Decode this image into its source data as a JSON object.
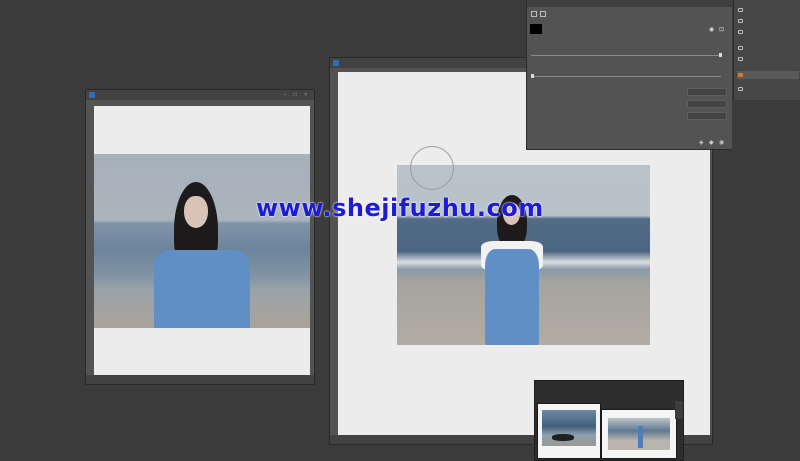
{
  "left_window": {
    "tab_title": "",
    "status": "",
    "controls": "– □ ×"
  },
  "right_window": {
    "tab_title": "",
    "status": ""
  },
  "panel": {
    "rows": [
      "",
      "",
      "",
      "",
      ""
    ],
    "buttons": [
      "",
      "",
      ""
    ]
  },
  "sidebar": {
    "items": [
      "",
      "",
      "",
      "",
      "",
      "",
      "",
      ""
    ]
  },
  "filmstrip": {
    "title": ""
  },
  "watermark": "www.shejifuzhu.com",
  "colors": {
    "app_bg": "#3b3b3b",
    "panel_bg": "#535353",
    "watermark": "#1d1bd6",
    "dress": "#5f8fc5"
  }
}
